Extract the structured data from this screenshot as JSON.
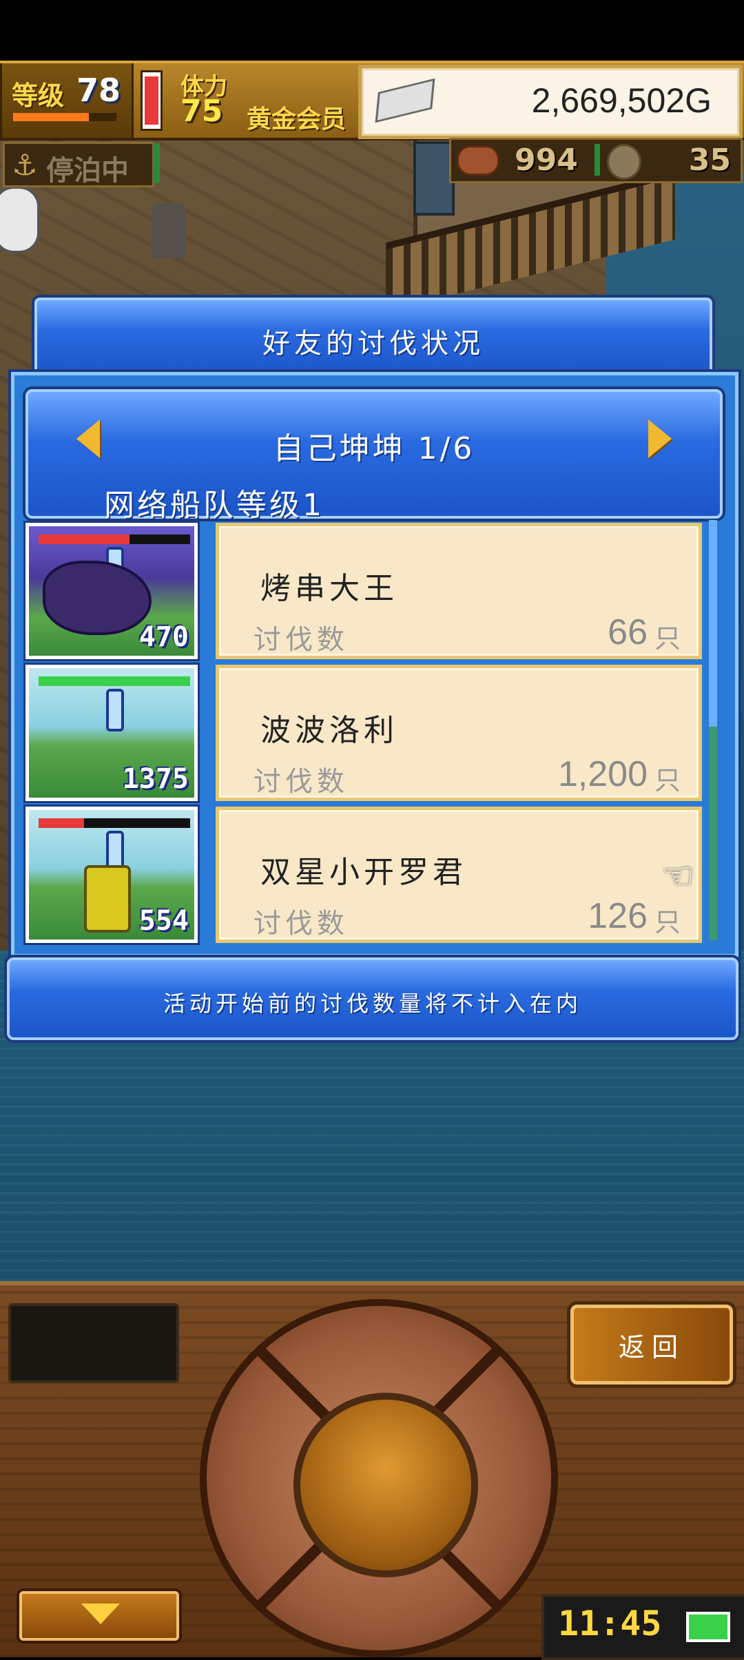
{
  "hud": {
    "level_label": "等级",
    "level_value": "78",
    "stamina_label": "体力",
    "stamina_value": "75",
    "member_label": "黄金会员",
    "gold": "2,669,502G",
    "docked_label": "停泊中",
    "meat_count": "994",
    "coin_count": "35"
  },
  "dialog": {
    "title": "好友的讨伐状况",
    "player_name": "自己坤坤 1/6",
    "fleet_level": "网络船队等级1",
    "kill_label": "讨伐数",
    "unit": "只",
    "rows": [
      {
        "monster_name": "烤串大王",
        "kills": "66",
        "level": "470"
      },
      {
        "monster_name": "波波洛利",
        "kills": "1,200",
        "level": "1375"
      },
      {
        "monster_name": "双星小开罗君",
        "kills": "126",
        "level": "554"
      }
    ],
    "note": "活动开始前的讨伐数量将不计入在内"
  },
  "controls": {
    "back_label": "返回",
    "clock": "11:45"
  },
  "colors": {
    "panel_blue": "#2a6ae0",
    "card_cream": "#f8e8c8",
    "gold_accent": "#f2b830"
  },
  "icons": [
    "anchor-icon",
    "meat-icon",
    "coin-icon",
    "silver-bar-icon",
    "arrow-left-icon",
    "arrow-right-icon",
    "pointing-hand-icon",
    "battery-icon"
  ]
}
